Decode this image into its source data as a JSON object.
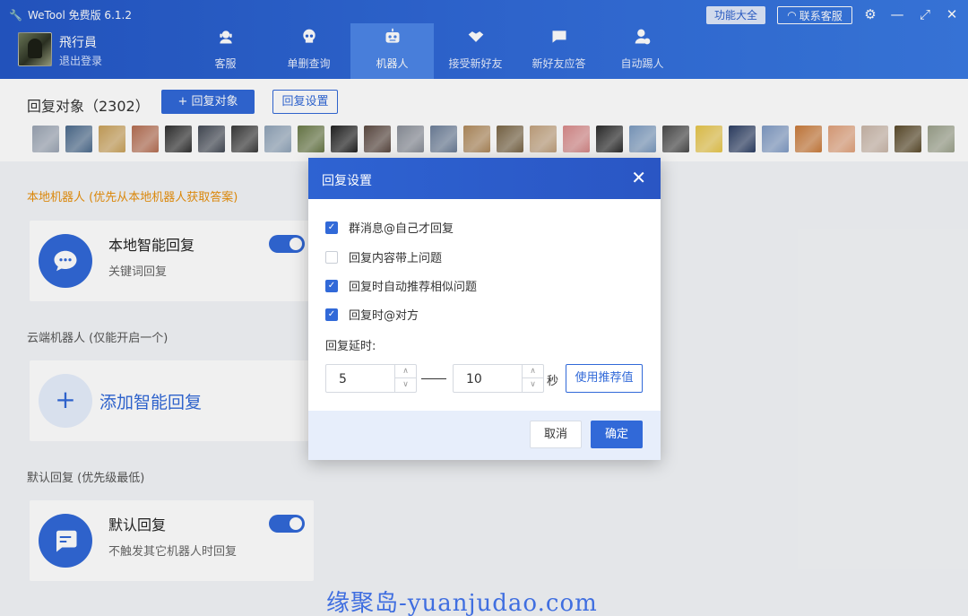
{
  "app": {
    "title": "WeTool 免费版 6.1.2"
  },
  "user": {
    "name": "飛行員",
    "logout": "退出登录"
  },
  "nav": [
    {
      "label": "客服",
      "icon": "support-agent-icon"
    },
    {
      "label": "单删查询",
      "icon": "skull-icon"
    },
    {
      "label": "机器人",
      "icon": "robot-icon"
    },
    {
      "label": "接受新好友",
      "icon": "handshake-icon"
    },
    {
      "label": "新好友应答",
      "icon": "chat-bubble-icon"
    },
    {
      "label": "自动踢人",
      "icon": "kick-user-icon"
    }
  ],
  "topbar": {
    "features": "功能大全",
    "contact": "联系客服"
  },
  "targets": {
    "title": "回复对象（2302）",
    "add_button": "+ 回复对象",
    "settings_button": "回复设置",
    "avatar_colors": [
      "#9aa4b3",
      "#4b6a8c",
      "#c9a15a",
      "#b56e52",
      "#2f2f2f",
      "#444a55",
      "#3a3a3a",
      "#8fa3b8",
      "#6a7a48",
      "#222222",
      "#5c4a42",
      "#8a8f99",
      "#6d7f99",
      "#b08a5c",
      "#7a6646",
      "#c2a27e",
      "#d98a8a",
      "#2b2b2b",
      "#7c9bc0",
      "#4a4a4a",
      "#e6c54a",
      "#2c3e63",
      "#7f9ac4",
      "#c97a3a",
      "#e0a07a",
      "#c9b6a8",
      "#5a4a2a",
      "#9aa08a"
    ]
  },
  "sections": {
    "local": {
      "label": "本地机器人 (优先从本地机器人获取答案)",
      "card_title": "本地智能回复",
      "card_sub": "关键词回复"
    },
    "cloud": {
      "label": "云端机器人 (仅能开启一个)",
      "add_label": "添加智能回复"
    },
    "default": {
      "label": "默认回复 (优先级最低)",
      "card_title": "默认回复",
      "card_sub": "不触发其它机器人时回复"
    }
  },
  "modal": {
    "title": "回复设置",
    "options": [
      {
        "label": "群消息@自己才回复",
        "checked": true
      },
      {
        "label": "回复内容带上问题",
        "checked": false
      },
      {
        "label": "回复时自动推荐相似问题",
        "checked": true
      },
      {
        "label": "回复时@对方",
        "checked": true
      }
    ],
    "delay_label": "回复延时:",
    "delay_min": "5",
    "delay_max": "10",
    "seconds": "秒",
    "recommend": "使用推荐值",
    "cancel": "取消",
    "confirm": "确定"
  },
  "watermark": "缘聚岛-yuanjudao.com"
}
